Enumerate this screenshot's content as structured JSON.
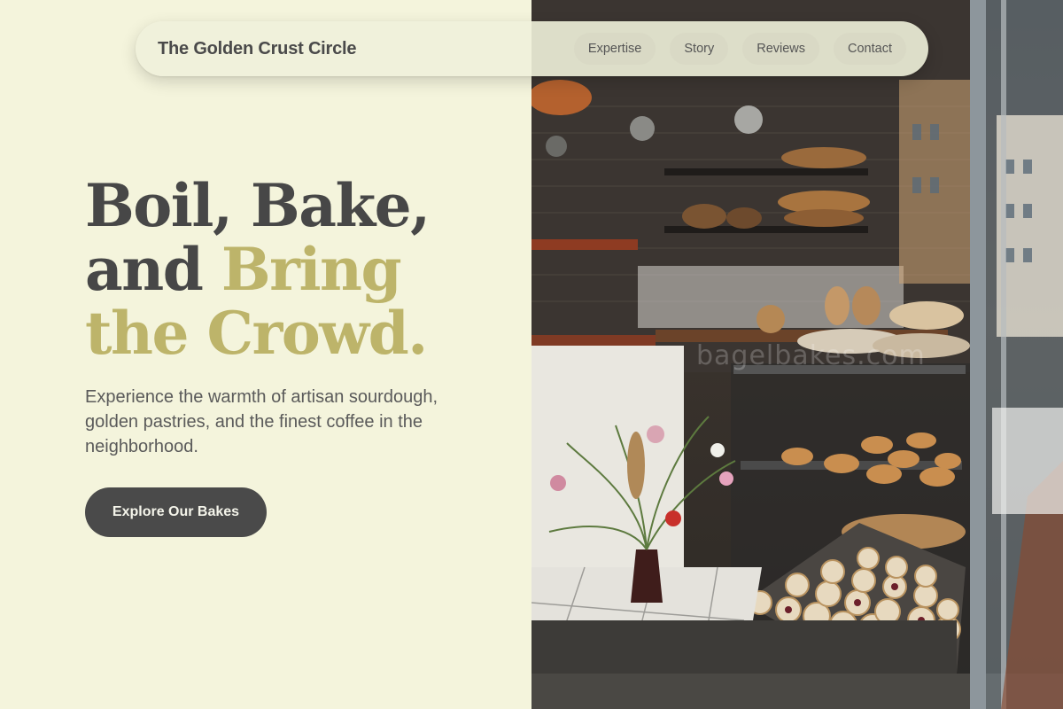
{
  "nav": {
    "brand": "The Golden Crust Circle",
    "links": [
      "Expertise",
      "Story",
      "Reviews",
      "Contact"
    ]
  },
  "hero": {
    "title_line1": "Boil, Bake,",
    "title_line2_plain": "and ",
    "title_line2_accent": "Bring",
    "title_line3_accent": "the Crowd.",
    "subtitle": "Experience the warmth of artisan sourdough, golden pastries, and the finest coffee in the neighborhood.",
    "cta_label": "Explore Our Bakes"
  },
  "photo": {
    "watermark": "bagelbakes.com",
    "alt": "Bakery shop window with bread shelves, pastries and a flower vase"
  },
  "colors": {
    "background": "#f4f4dc",
    "text": "#4a4a4a",
    "accent": "#bdb46a",
    "button": "#4a4a4a"
  }
}
